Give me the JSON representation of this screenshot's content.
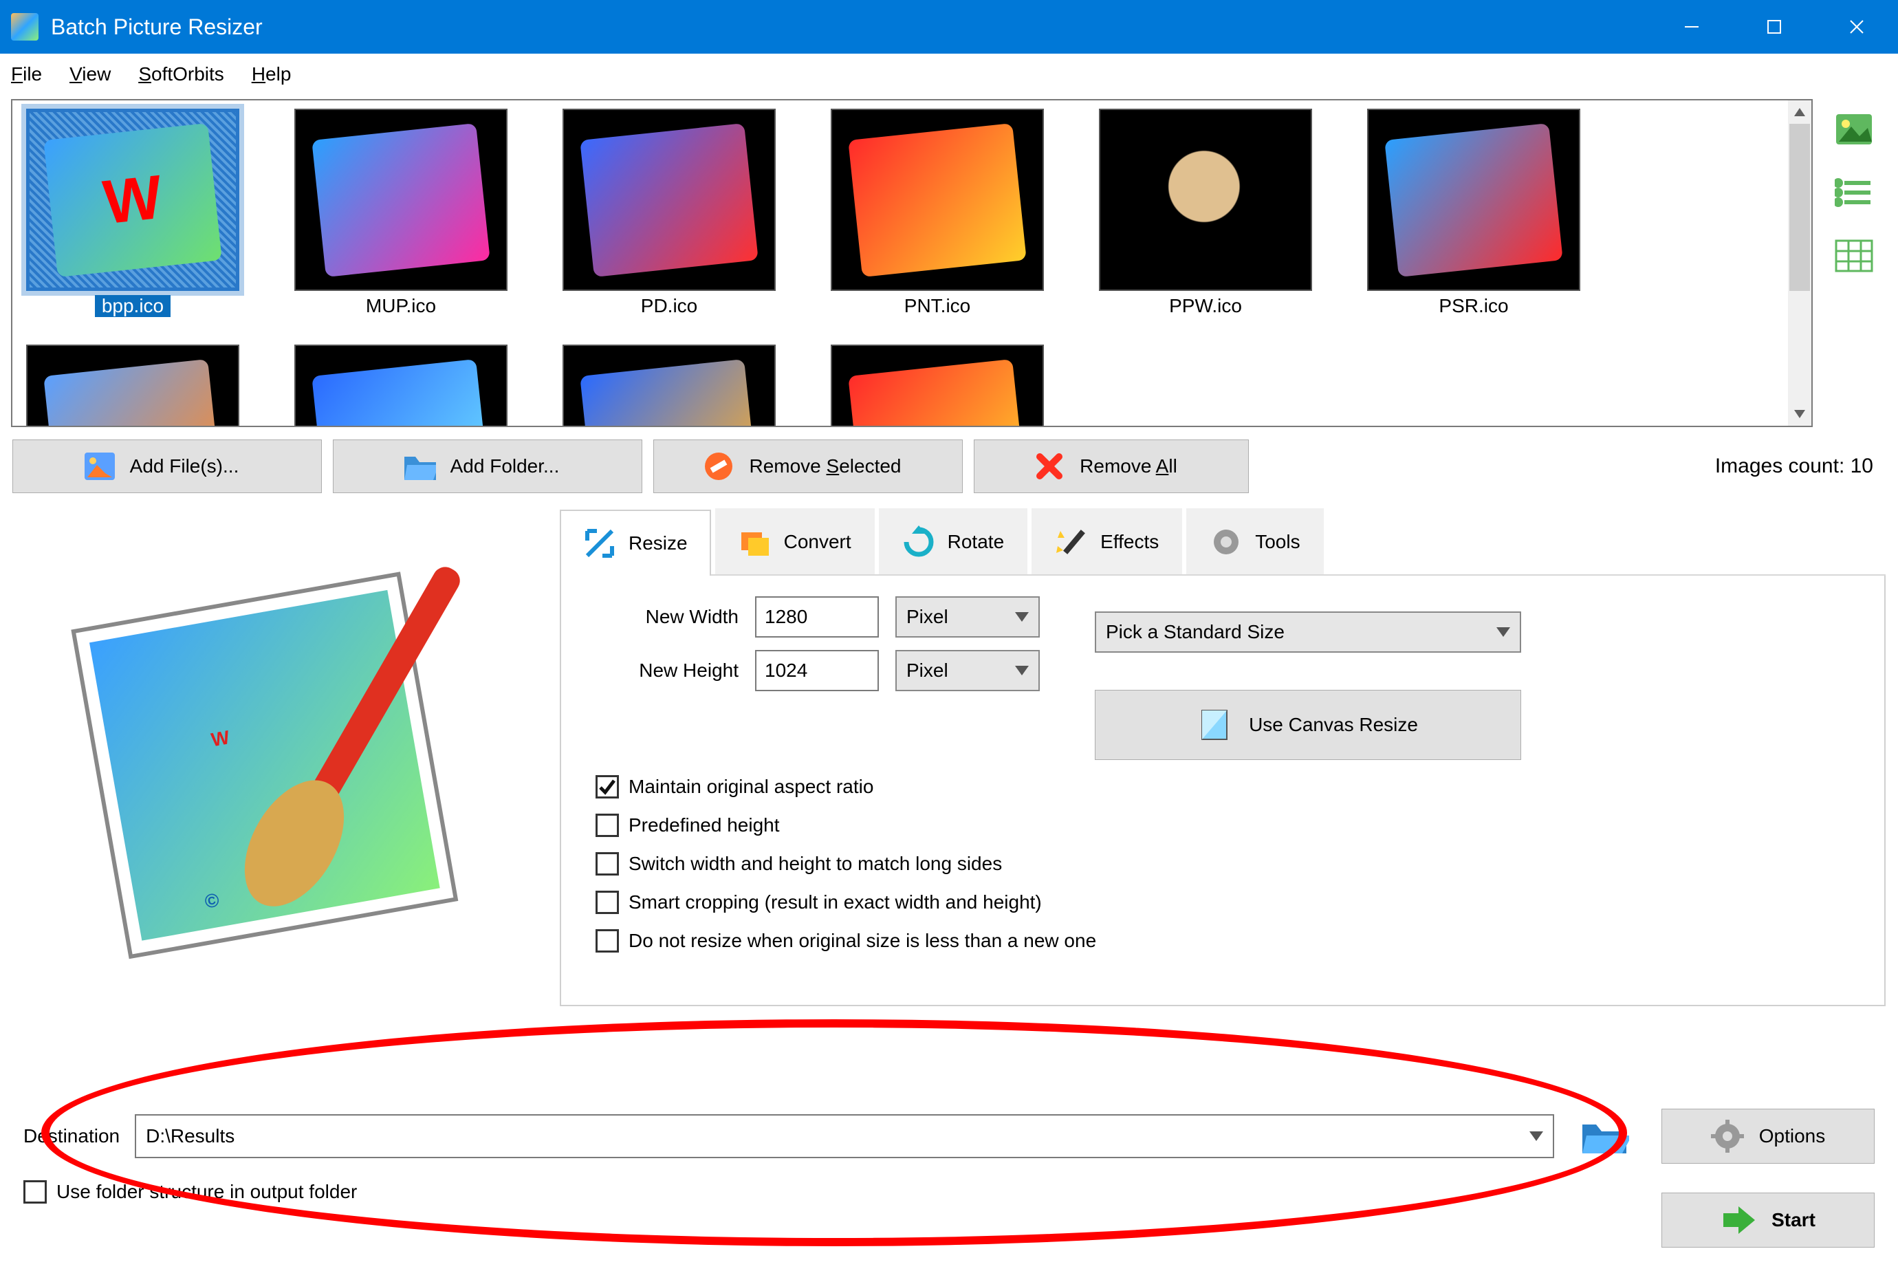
{
  "titlebar": {
    "title": "Batch Picture Resizer"
  },
  "menu": {
    "file": "File",
    "view": "View",
    "softorbits": "SoftOrbits",
    "help": "Help"
  },
  "gallery": {
    "items": [
      {
        "name": "bpp.ico"
      },
      {
        "name": "MUP.ico"
      },
      {
        "name": "PD.ico"
      },
      {
        "name": "PNT.ico"
      },
      {
        "name": "PPW.ico"
      },
      {
        "name": "PSR.ico"
      }
    ]
  },
  "toolbar": {
    "add_files": "Add File(s)...",
    "add_folder": "Add Folder...",
    "remove_selected_pre": "Remove ",
    "remove_selected_u": "S",
    "remove_selected_post": "elected",
    "remove_all_pre": "Remove ",
    "remove_all_u": "A",
    "remove_all_post": "ll",
    "count_label": "Images count: 10"
  },
  "tabs": {
    "resize": "Resize",
    "convert": "Convert",
    "rotate": "Rotate",
    "effects": "Effects",
    "tools": "Tools"
  },
  "resize": {
    "new_width_label": "New Width",
    "new_width": "1280",
    "new_height_label": "New Height",
    "new_height": "1024",
    "unit": "Pixel",
    "std_size": "Pick a Standard Size",
    "canvas_btn": "Use Canvas Resize",
    "cb_aspect": "Maintain original aspect ratio",
    "cb_predef": "Predefined height",
    "cb_switch": "Switch width and height to match long sides",
    "cb_smart": "Smart cropping (result in exact width and height)",
    "cb_noresize": "Do not resize when original size is less than a new one"
  },
  "dest": {
    "label": "Destination",
    "value": "D:\\Results",
    "options": "Options",
    "start": "Start",
    "folder_cb": "Use folder structure in output folder"
  }
}
